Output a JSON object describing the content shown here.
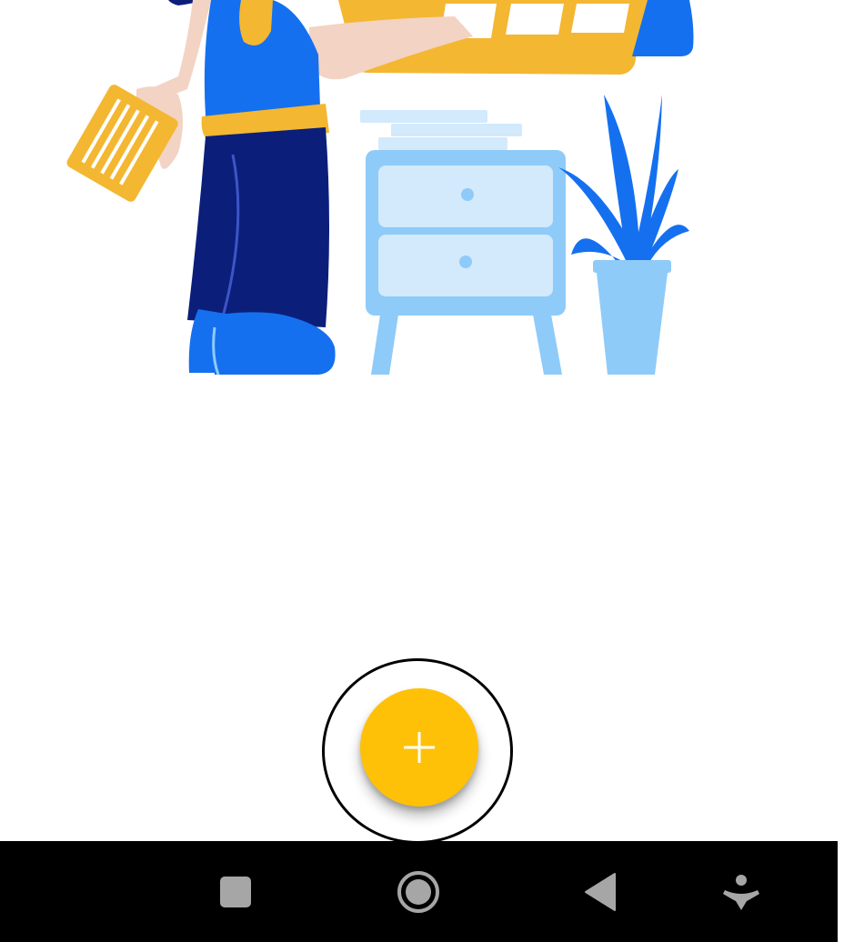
{
  "illustration": {
    "name": "person-loading-shelf-illustration",
    "colors": {
      "primary_blue": "#1570EF",
      "dark_navy": "#0B1F7A",
      "light_blue": "#8ECBF8",
      "pale_blue": "#D3E9FC",
      "yellow": "#F4B731",
      "skin": "#F3D3C3"
    }
  },
  "fab": {
    "icon": "plus-icon",
    "color": "#FFC107",
    "highlighted": true
  },
  "navbar": {
    "buttons": [
      {
        "icon": "recents-square-icon"
      },
      {
        "icon": "home-circle-icon"
      },
      {
        "icon": "back-triangle-icon"
      },
      {
        "icon": "accessibility-icon"
      }
    ],
    "background": "#000000",
    "icon_color": "#A6A6A6"
  }
}
